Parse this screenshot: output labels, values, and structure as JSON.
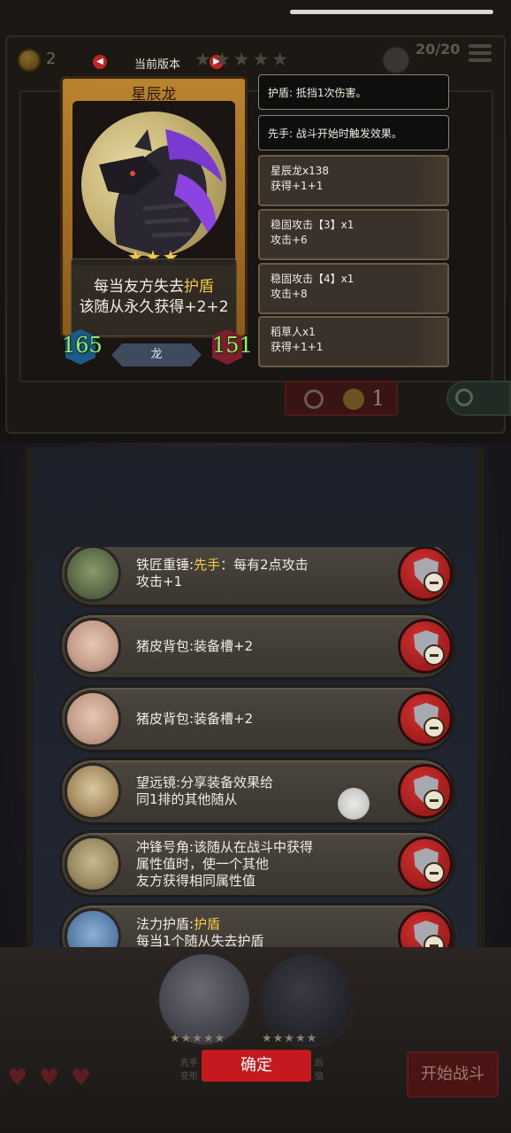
{
  "top": {
    "gold": "2",
    "version_label": "当前版本",
    "stars": "★★★★★",
    "team_count": "20/20"
  },
  "card": {
    "name": "星辰龙",
    "stars": "★★★",
    "desc_line1_pre": "每当友方失去",
    "desc_line1_keyword": "护盾",
    "desc_line2": "该随从永久获得+2+2",
    "attack": "165",
    "health": "151",
    "tribe": "龙"
  },
  "keywords": [
    {
      "text": "护盾: 抵挡1次伤害。"
    },
    {
      "text": "先手: 战斗开始时触发效果。"
    }
  ],
  "triggers": [
    {
      "name": "星辰龙x138",
      "amount": "获得+1+1"
    },
    {
      "name": "稳固攻击【3】x1",
      "amount": "攻击+6"
    },
    {
      "name": "稳固攻击【4】x1",
      "amount": "攻击+8"
    },
    {
      "name": "稻草人x1",
      "amount": "获得+1+1"
    }
  ],
  "refresh_cost": "1",
  "equipment": [
    {
      "line1_pre": "铁匠重锤:",
      "line1_kw": "先手",
      "line1_post": "：每有2点攻击",
      "line2": "攻击+1",
      "line3": ""
    },
    {
      "line1_pre": "猪皮背包:装备槽+2",
      "line1_kw": "",
      "line1_post": "",
      "line2": "",
      "line3": ""
    },
    {
      "line1_pre": "猪皮背包:装备槽+2",
      "line1_kw": "",
      "line1_post": "",
      "line2": "",
      "line3": ""
    },
    {
      "line1_pre": "望远镜:分享装备效果给",
      "line1_kw": "",
      "line1_post": "",
      "line2": "同1排的其他随从",
      "line3": ""
    },
    {
      "line1_pre": "冲锋号角:该随从在战斗中获得",
      "line1_kw": "",
      "line1_post": "",
      "line2": "属性值时，使一个其他",
      "line3": "友方获得相同属性值"
    },
    {
      "line1_pre": "法力护盾:",
      "line1_kw": "护盾",
      "line1_post": "",
      "line2": "每当1个随从失去护盾",
      "line3": ""
    }
  ],
  "bottom": {
    "confirm_label": "确定",
    "start_label": "开始战斗",
    "left_hint": "先手\n变形",
    "right_hint": "后\n值",
    "slot_stars": "★★★★★"
  },
  "colors": {
    "accent_red": "#c41a1f",
    "keyword_gold": "#f2c94a",
    "attack_green": "#9be86e"
  }
}
